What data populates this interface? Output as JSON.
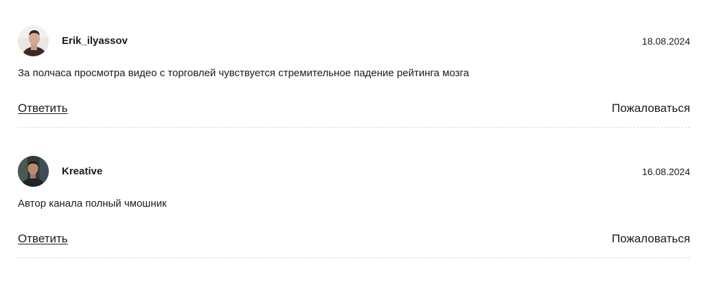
{
  "comments": [
    {
      "author": "Erik_ilyassov",
      "date": "18.08.2024",
      "text": "За полчаса просмотра видео с торговлей чувствуется стремительное падение рейтинга мозга",
      "reply_label": "Ответить",
      "report_label": "Пожаловаться",
      "avatar_icon": "user-photo-icon"
    },
    {
      "author": "Kreative",
      "date": "16.08.2024",
      "text": "Автор канала полный чмошник",
      "reply_label": "Ответить",
      "report_label": "Пожаловаться",
      "avatar_icon": "user-photo-icon"
    }
  ],
  "colors": {
    "text": "#1a1a1a",
    "divider": "#dcdcdc",
    "background": "#ffffff"
  }
}
